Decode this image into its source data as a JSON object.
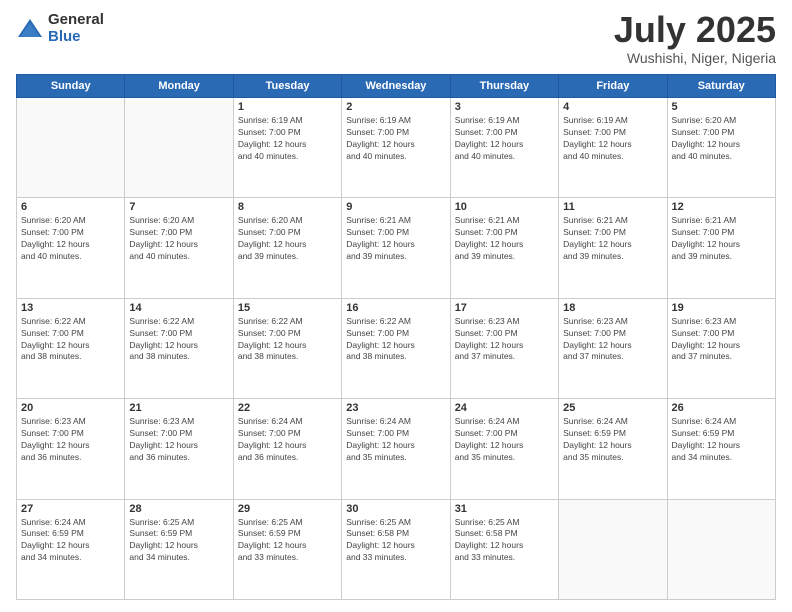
{
  "header": {
    "logo_general": "General",
    "logo_blue": "Blue",
    "month_title": "July 2025",
    "location": "Wushishi, Niger, Nigeria"
  },
  "days_of_week": [
    "Sunday",
    "Monday",
    "Tuesday",
    "Wednesday",
    "Thursday",
    "Friday",
    "Saturday"
  ],
  "weeks": [
    [
      {
        "day": "",
        "info": ""
      },
      {
        "day": "",
        "info": ""
      },
      {
        "day": "1",
        "info": "Sunrise: 6:19 AM\nSunset: 7:00 PM\nDaylight: 12 hours\nand 40 minutes."
      },
      {
        "day": "2",
        "info": "Sunrise: 6:19 AM\nSunset: 7:00 PM\nDaylight: 12 hours\nand 40 minutes."
      },
      {
        "day": "3",
        "info": "Sunrise: 6:19 AM\nSunset: 7:00 PM\nDaylight: 12 hours\nand 40 minutes."
      },
      {
        "day": "4",
        "info": "Sunrise: 6:19 AM\nSunset: 7:00 PM\nDaylight: 12 hours\nand 40 minutes."
      },
      {
        "day": "5",
        "info": "Sunrise: 6:20 AM\nSunset: 7:00 PM\nDaylight: 12 hours\nand 40 minutes."
      }
    ],
    [
      {
        "day": "6",
        "info": "Sunrise: 6:20 AM\nSunset: 7:00 PM\nDaylight: 12 hours\nand 40 minutes."
      },
      {
        "day": "7",
        "info": "Sunrise: 6:20 AM\nSunset: 7:00 PM\nDaylight: 12 hours\nand 40 minutes."
      },
      {
        "day": "8",
        "info": "Sunrise: 6:20 AM\nSunset: 7:00 PM\nDaylight: 12 hours\nand 39 minutes."
      },
      {
        "day": "9",
        "info": "Sunrise: 6:21 AM\nSunset: 7:00 PM\nDaylight: 12 hours\nand 39 minutes."
      },
      {
        "day": "10",
        "info": "Sunrise: 6:21 AM\nSunset: 7:00 PM\nDaylight: 12 hours\nand 39 minutes."
      },
      {
        "day": "11",
        "info": "Sunrise: 6:21 AM\nSunset: 7:00 PM\nDaylight: 12 hours\nand 39 minutes."
      },
      {
        "day": "12",
        "info": "Sunrise: 6:21 AM\nSunset: 7:00 PM\nDaylight: 12 hours\nand 39 minutes."
      }
    ],
    [
      {
        "day": "13",
        "info": "Sunrise: 6:22 AM\nSunset: 7:00 PM\nDaylight: 12 hours\nand 38 minutes."
      },
      {
        "day": "14",
        "info": "Sunrise: 6:22 AM\nSunset: 7:00 PM\nDaylight: 12 hours\nand 38 minutes."
      },
      {
        "day": "15",
        "info": "Sunrise: 6:22 AM\nSunset: 7:00 PM\nDaylight: 12 hours\nand 38 minutes."
      },
      {
        "day": "16",
        "info": "Sunrise: 6:22 AM\nSunset: 7:00 PM\nDaylight: 12 hours\nand 38 minutes."
      },
      {
        "day": "17",
        "info": "Sunrise: 6:23 AM\nSunset: 7:00 PM\nDaylight: 12 hours\nand 37 minutes."
      },
      {
        "day": "18",
        "info": "Sunrise: 6:23 AM\nSunset: 7:00 PM\nDaylight: 12 hours\nand 37 minutes."
      },
      {
        "day": "19",
        "info": "Sunrise: 6:23 AM\nSunset: 7:00 PM\nDaylight: 12 hours\nand 37 minutes."
      }
    ],
    [
      {
        "day": "20",
        "info": "Sunrise: 6:23 AM\nSunset: 7:00 PM\nDaylight: 12 hours\nand 36 minutes."
      },
      {
        "day": "21",
        "info": "Sunrise: 6:23 AM\nSunset: 7:00 PM\nDaylight: 12 hours\nand 36 minutes."
      },
      {
        "day": "22",
        "info": "Sunrise: 6:24 AM\nSunset: 7:00 PM\nDaylight: 12 hours\nand 36 minutes."
      },
      {
        "day": "23",
        "info": "Sunrise: 6:24 AM\nSunset: 7:00 PM\nDaylight: 12 hours\nand 35 minutes."
      },
      {
        "day": "24",
        "info": "Sunrise: 6:24 AM\nSunset: 7:00 PM\nDaylight: 12 hours\nand 35 minutes."
      },
      {
        "day": "25",
        "info": "Sunrise: 6:24 AM\nSunset: 6:59 PM\nDaylight: 12 hours\nand 35 minutes."
      },
      {
        "day": "26",
        "info": "Sunrise: 6:24 AM\nSunset: 6:59 PM\nDaylight: 12 hours\nand 34 minutes."
      }
    ],
    [
      {
        "day": "27",
        "info": "Sunrise: 6:24 AM\nSunset: 6:59 PM\nDaylight: 12 hours\nand 34 minutes."
      },
      {
        "day": "28",
        "info": "Sunrise: 6:25 AM\nSunset: 6:59 PM\nDaylight: 12 hours\nand 34 minutes."
      },
      {
        "day": "29",
        "info": "Sunrise: 6:25 AM\nSunset: 6:59 PM\nDaylight: 12 hours\nand 33 minutes."
      },
      {
        "day": "30",
        "info": "Sunrise: 6:25 AM\nSunset: 6:58 PM\nDaylight: 12 hours\nand 33 minutes."
      },
      {
        "day": "31",
        "info": "Sunrise: 6:25 AM\nSunset: 6:58 PM\nDaylight: 12 hours\nand 33 minutes."
      },
      {
        "day": "",
        "info": ""
      },
      {
        "day": "",
        "info": ""
      }
    ]
  ]
}
